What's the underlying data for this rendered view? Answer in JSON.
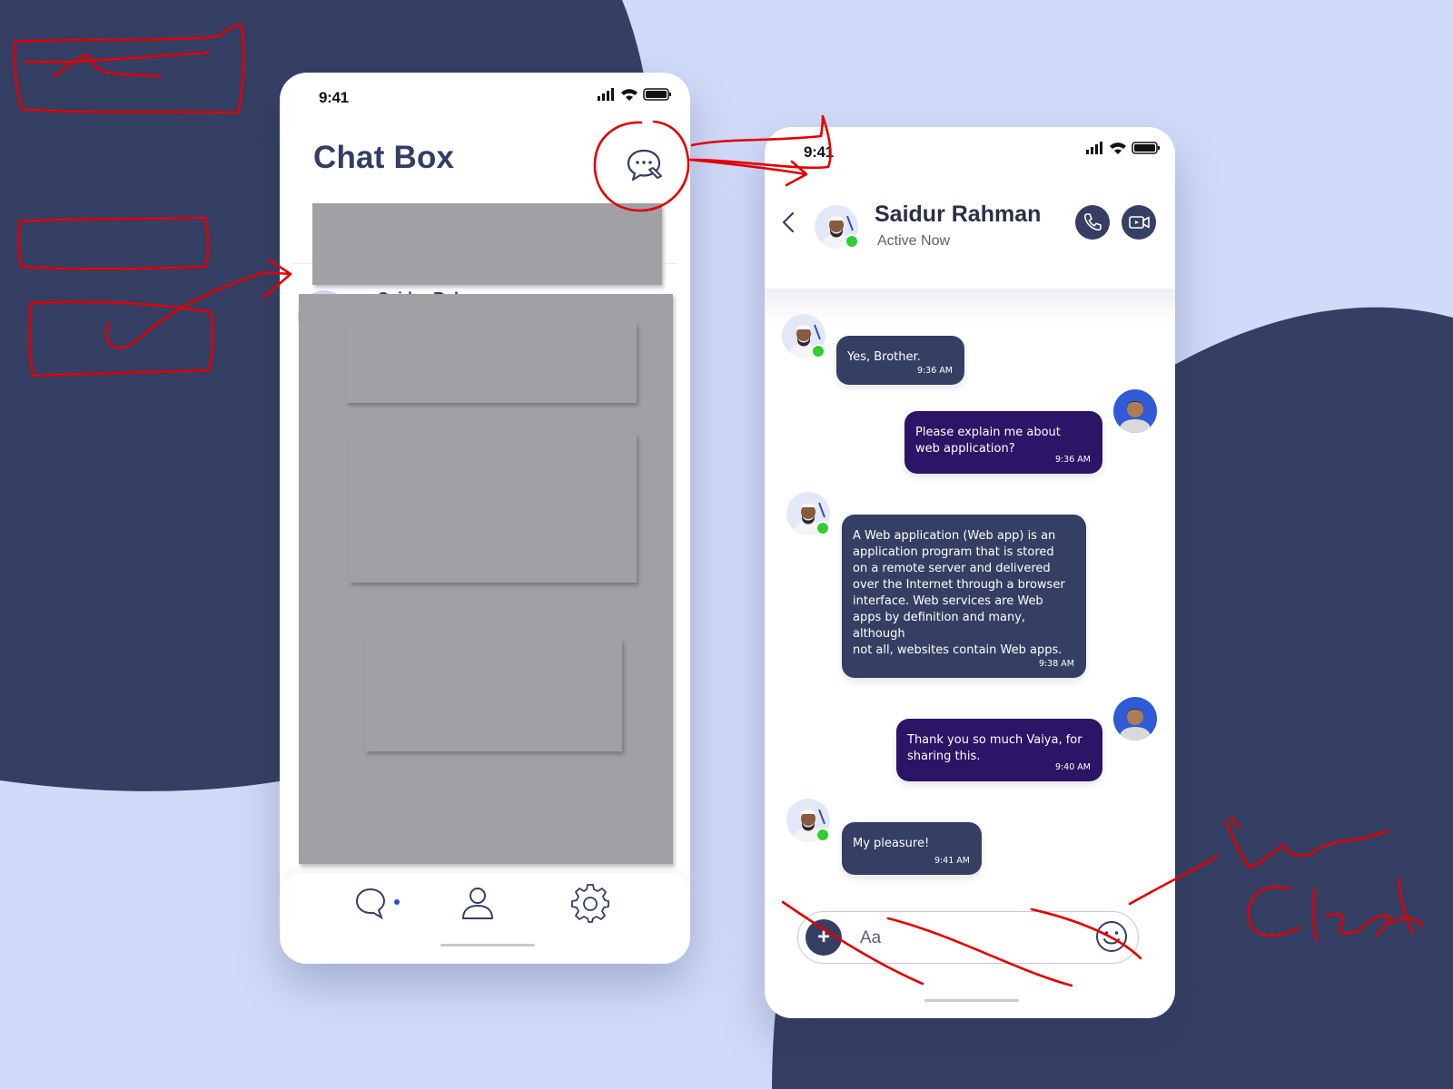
{
  "colors": {
    "page_bg_light": "#d1dbf9",
    "page_bg_dark": "#353f63",
    "accent": "#363f63",
    "incoming_bubble": "#353f63",
    "outgoing_bubble": "#2c1466",
    "online": "#32cd32",
    "annotation": "#e10000"
  },
  "left_phone": {
    "status_time": "9:41",
    "title": "Chat Box",
    "new_chat_icon": "chat-bubble-edit-icon",
    "partial_list_text": "Saidur Rah",
    "bottom_nav": [
      {
        "icon": "chat-icon",
        "active": true
      },
      {
        "icon": "user-icon",
        "active": false
      },
      {
        "icon": "gear-icon",
        "active": false
      }
    ]
  },
  "right_phone": {
    "status_time": "9:41",
    "contact": {
      "name": "Saidur Rahman",
      "status": "Active Now"
    },
    "header_actions": [
      "phone-icon",
      "video-camera-icon"
    ],
    "messages": [
      {
        "direction": "in",
        "text": "Yes, Brother.",
        "time": "9:36 AM"
      },
      {
        "direction": "out",
        "text": "Please explain me about\nweb application?",
        "time": "9:36 AM"
      },
      {
        "direction": "in",
        "text": "A Web application (Web app) is an\napplication program that is stored\non a remote server and delivered\nover the Internet through a browser\ninterface. Web services are Web\napps by definition and many, although\nnot all, websites contain Web apps.",
        "time": "9:38 AM"
      },
      {
        "direction": "out",
        "text": "Thank you so much Vaiya, for\nsharing this.",
        "time": "9:40 AM"
      },
      {
        "direction": "in",
        "text": "My pleasure!",
        "time": "9:41 AM"
      }
    ],
    "composer": {
      "placeholder": "Aa",
      "add_icon": "plus-icon",
      "emoji_icon": "smiley-icon"
    }
  }
}
